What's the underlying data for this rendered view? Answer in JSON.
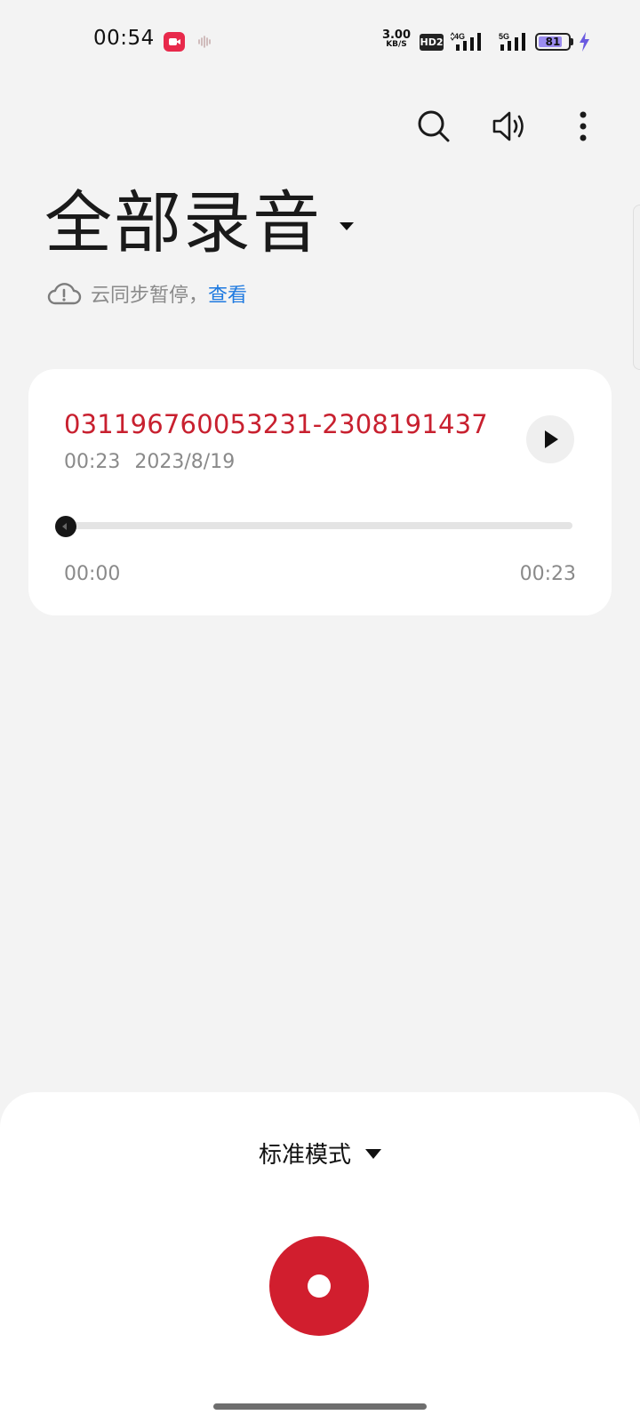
{
  "status_bar": {
    "time": "00:54",
    "net_speed_value": "3.00",
    "net_speed_unit": "KB/S",
    "hd_label": "HD2",
    "signal_1_label": "4G",
    "signal_2_label": "5G",
    "battery_level": "81",
    "battery_fraction": 0.81
  },
  "header": {
    "title": "全部录音",
    "sync_text": "云同步暂停，",
    "sync_link": "查看"
  },
  "recording": {
    "name": "031196760053231-2308191437",
    "duration": "00:23",
    "date": "2023/8/19",
    "position_label": "00:00",
    "total_label": "00:23",
    "progress_fraction": 0.0
  },
  "bottom": {
    "mode_label": "标准模式"
  },
  "colors": {
    "accent_red": "#d11e2e",
    "link_blue": "#1f7ae0",
    "title_red": "#c8202f",
    "battery_purple": "#9b8cf0"
  }
}
